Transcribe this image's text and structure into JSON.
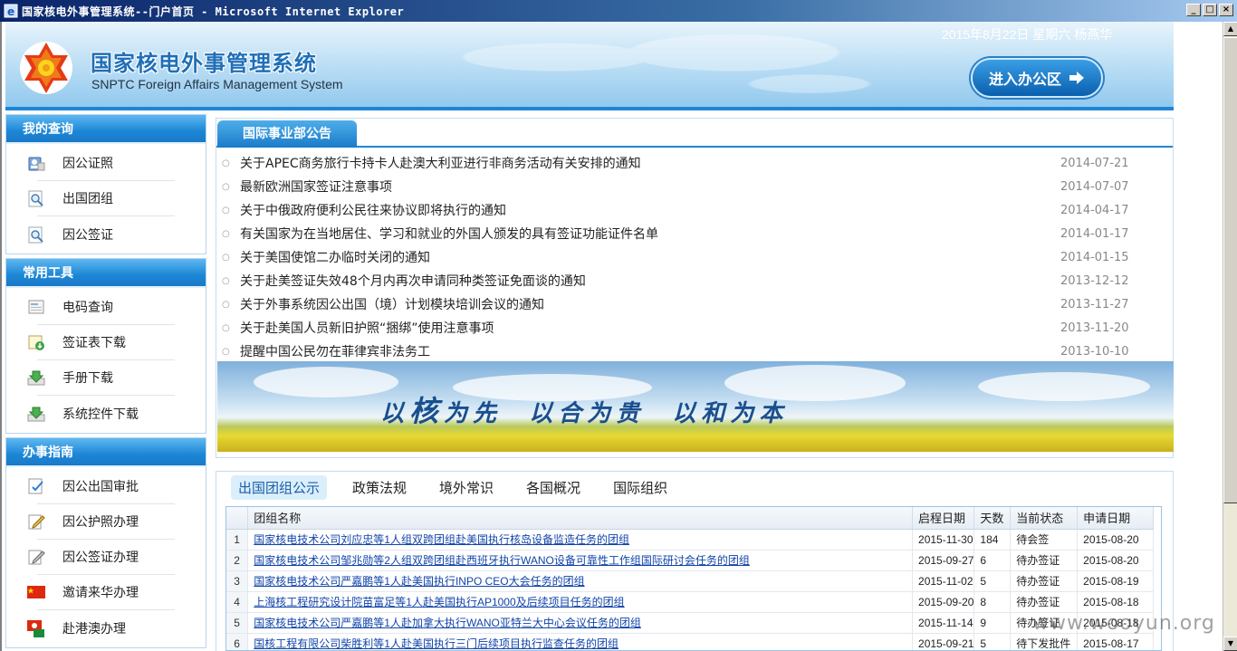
{
  "window": {
    "title": "国家核电外事管理系统--门户首页 - Microsoft Internet Explorer",
    "buttons": [
      "_",
      "□",
      "×"
    ]
  },
  "header": {
    "system_title": "国家核电外事管理系统",
    "system_subtitle": "SNPTC  Foreign Affairs Management System",
    "user_info": "2015年8月22日  星期六  杨燕华",
    "enter_button": "进入办公区",
    "enter_icon": "arrow-right-icon"
  },
  "sidebar": {
    "sections": [
      {
        "title": "我的查询",
        "items": [
          {
            "label": "因公证照",
            "icon": "passport-user-icon"
          },
          {
            "label": "出国团组",
            "icon": "magnifier-doc-icon"
          },
          {
            "label": "因公签证",
            "icon": "magnifier-doc-icon"
          }
        ]
      },
      {
        "title": "常用工具",
        "items": [
          {
            "label": "电码查询",
            "icon": "document-icon"
          },
          {
            "label": "签证表下载",
            "icon": "download-doc-icon"
          },
          {
            "label": "手册下载",
            "icon": "download-tray-icon"
          },
          {
            "label": "系统控件下载",
            "icon": "download-tray-icon"
          }
        ]
      },
      {
        "title": "办事指南",
        "items": [
          {
            "label": "因公出国审批",
            "icon": "approve-doc-icon"
          },
          {
            "label": "因公护照办理",
            "icon": "edit-doc-icon"
          },
          {
            "label": "因公签证办理",
            "icon": "edit-doc-icon"
          },
          {
            "label": "邀请来华办理",
            "icon": "china-flag-icon"
          },
          {
            "label": "赴港澳办理",
            "icon": "hk-flag-icon"
          }
        ]
      }
    ]
  },
  "notice": {
    "tab_label": "国际事业部公告",
    "items": [
      {
        "title": "关于APEC商务旅行卡持卡人赴澳大利亚进行非商务活动有关安排的通知",
        "date": "2014-07-21"
      },
      {
        "title": "最新欧洲国家签证注意事项",
        "date": "2014-07-07"
      },
      {
        "title": "关于中俄政府便利公民往来协议即将执行的通知",
        "date": "2014-04-17"
      },
      {
        "title": "有关国家为在当地居住、学习和就业的外国人颁发的具有签证功能证件名单",
        "date": "2014-01-17"
      },
      {
        "title": "关于美国使馆二办临时关闭的通知",
        "date": "2014-01-15"
      },
      {
        "title": "关于赴美签证失效48个月内再次申请同种类签证免面谈的通知",
        "date": "2013-12-12"
      },
      {
        "title": "关于外事系统因公出国（境）计划模块培训会议的通知",
        "date": "2013-11-27"
      },
      {
        "title": "关于赴美国人员新旧护照“捆绑”使用注意事项",
        "date": "2013-11-20"
      },
      {
        "title": "提醒中国公民勿在菲律宾非法务工",
        "date": "2013-10-10"
      }
    ]
  },
  "banner": {
    "slogan_1a": "以",
    "slogan_1b": "核",
    "slogan_1c": "为先",
    "slogan_2": "以合为贵",
    "slogan_3": "以和为本"
  },
  "tabs": {
    "items": [
      "出国团组公示",
      "政策法规",
      "境外常识",
      "各国概况",
      "国际组织"
    ],
    "active": 0
  },
  "table": {
    "headers": [
      "",
      "团组名称",
      "启程日期",
      "天数",
      "当前状态",
      "申请日期"
    ],
    "rows": [
      {
        "no": "1",
        "name": "国家核电技术公司刘应忠等1人组双跨团组赴美国执行核岛设备监造任务的团组",
        "start": "2015-11-30",
        "days": "184",
        "status": "待会签",
        "applied": "2015-08-20"
      },
      {
        "no": "2",
        "name": "国家核电技术公司邹兆勋等2人组双跨团组赴西班牙执行WANO设备可靠性工作组国际研讨会任务的团组",
        "start": "2015-09-27",
        "days": "6",
        "status": "待办签证",
        "applied": "2015-08-20"
      },
      {
        "no": "3",
        "name": "国家核电技术公司严嘉鹏等1人赴美国执行INPO CEO大会任务的团组",
        "start": "2015-11-02",
        "days": "5",
        "status": "待办签证",
        "applied": "2015-08-19"
      },
      {
        "no": "4",
        "name": "上海核工程研究设计院苗富足等1人赴美国执行AP1000及后续项目任务的团组",
        "start": "2015-09-20",
        "days": "8",
        "status": "待办签证",
        "applied": "2015-08-18"
      },
      {
        "no": "5",
        "name": "国家核电技术公司严嘉鹏等1人赴加拿大执行WANO亚特兰大中心会议任务的团组",
        "start": "2015-11-14",
        "days": "9",
        "status": "待办签证",
        "applied": "2015-08-18"
      },
      {
        "no": "6",
        "name": "国核工程有限公司柴胜利等1人赴美国执行三门后续项目执行监查任务的团组",
        "start": "2015-09-21",
        "days": "5",
        "status": "待下发批件",
        "applied": "2015-08-17"
      }
    ]
  },
  "watermark": "www.wooyun.org",
  "colors": {
    "accent": "#1f86d6",
    "link": "#1144aa",
    "titlebar": "#0a246a"
  }
}
